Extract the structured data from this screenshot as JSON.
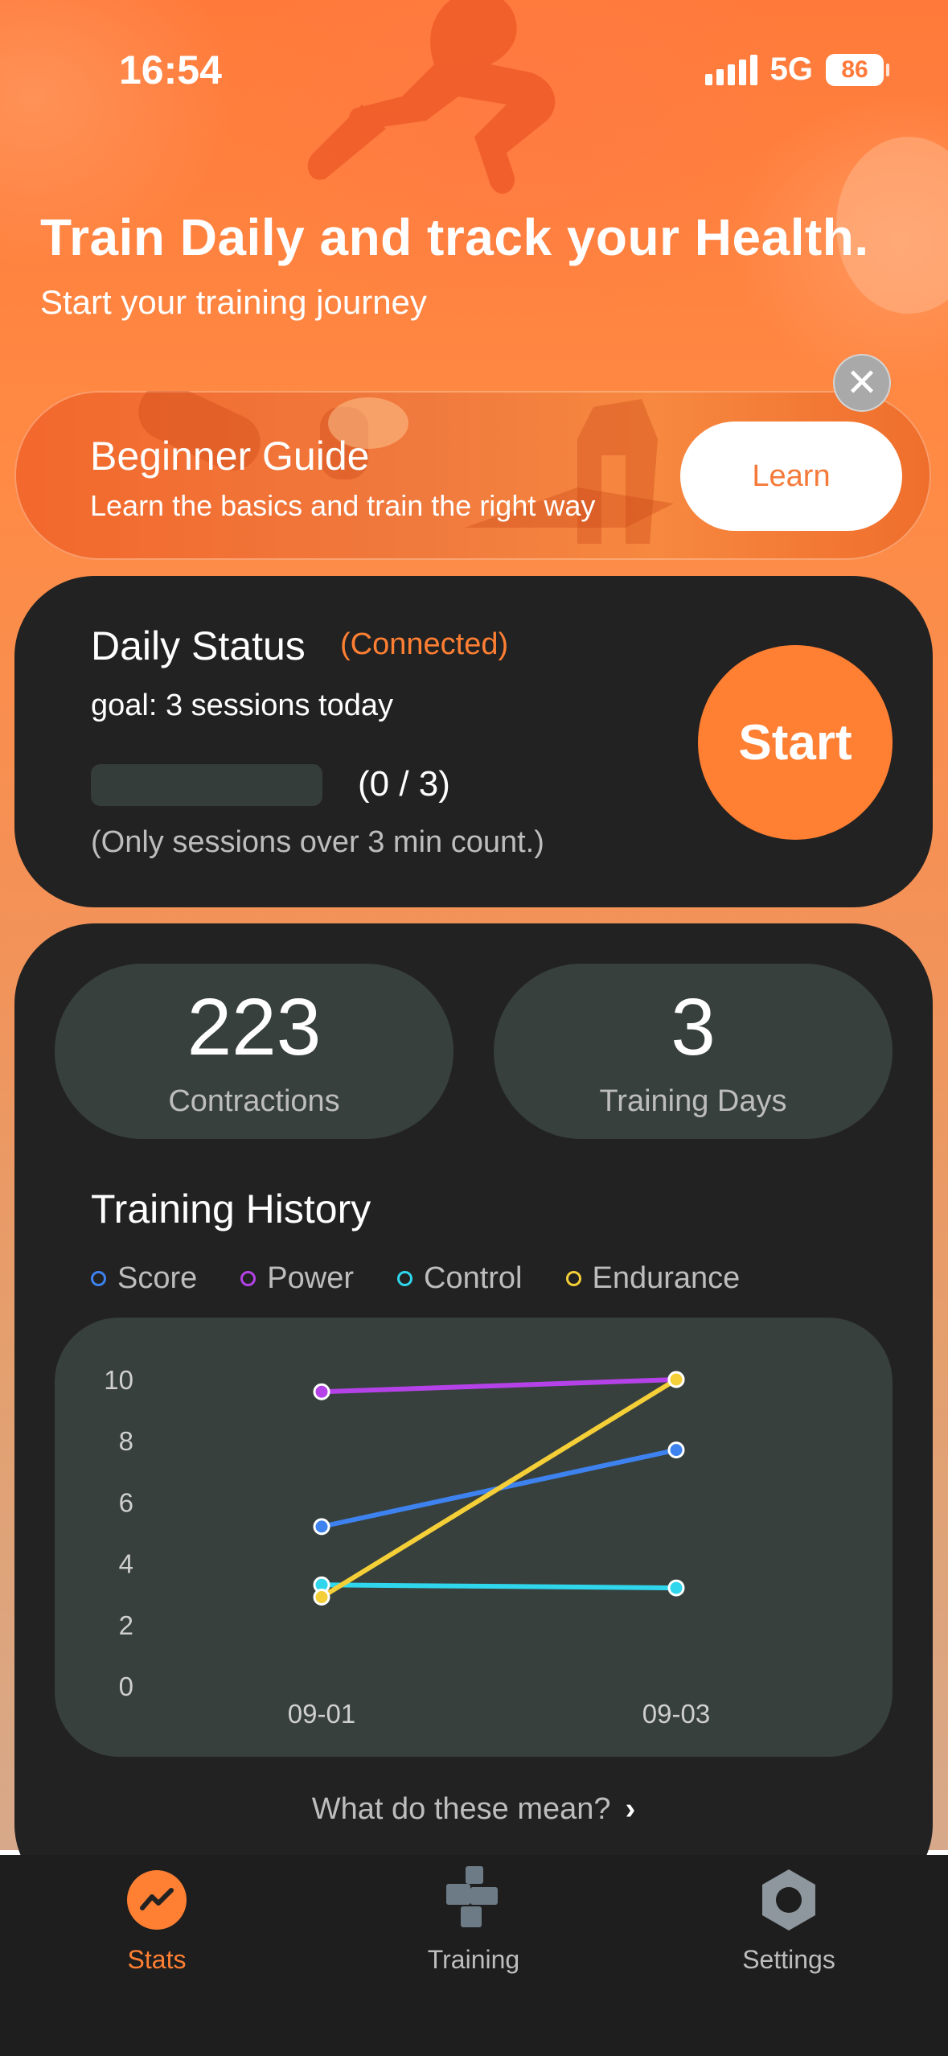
{
  "status_bar": {
    "time": "16:54",
    "network": "5G",
    "battery": "86"
  },
  "hero": {
    "title": "Train Daily and track your Health.",
    "subtitle": "Start your training journey"
  },
  "guide": {
    "title": "Beginner Guide",
    "subtitle": "Learn the basics and train the right way",
    "learn_label": "Learn",
    "close_label": "✕"
  },
  "daily": {
    "title": "Daily Status",
    "connection": "(Connected)",
    "goal": "goal: 3 sessions today",
    "progress_text": "(0 / 3)",
    "progress_fraction": 0,
    "note": "(Only sessions over 3 min count.)",
    "start_label": "Start"
  },
  "stats": {
    "contractions": {
      "value": "223",
      "label": "Contractions"
    },
    "training_days": {
      "value": "3",
      "label": "Training Days"
    }
  },
  "history": {
    "title": "Training History",
    "more_label": "What do these mean?"
  },
  "colors": {
    "accent": "#ff7f33",
    "card": "#222222",
    "panel": "#37403d"
  },
  "chart_data": {
    "type": "line",
    "categories": [
      "09-01",
      "09-03"
    ],
    "ylim": [
      0,
      10
    ],
    "yticks": [
      "0",
      "2",
      "4",
      "6",
      "8",
      "10"
    ],
    "grid": false,
    "legend_position": "top-left",
    "series": [
      {
        "name": "Score",
        "color": "#3d82ee",
        "values": [
          5.2,
          7.7
        ]
      },
      {
        "name": "Power",
        "color": "#b542e8",
        "values": [
          9.6,
          10.0
        ]
      },
      {
        "name": "Control",
        "color": "#2fd6ec",
        "values": [
          3.3,
          3.2
        ]
      },
      {
        "name": "Endurance",
        "color": "#f5cf37",
        "values": [
          2.9,
          10.0
        ]
      }
    ]
  },
  "tabs": [
    {
      "label": "Stats",
      "icon": "trend-icon",
      "active": true
    },
    {
      "label": "Training",
      "icon": "blocks-icon",
      "active": false
    },
    {
      "label": "Settings",
      "icon": "hexagon-icon",
      "active": false
    }
  ]
}
